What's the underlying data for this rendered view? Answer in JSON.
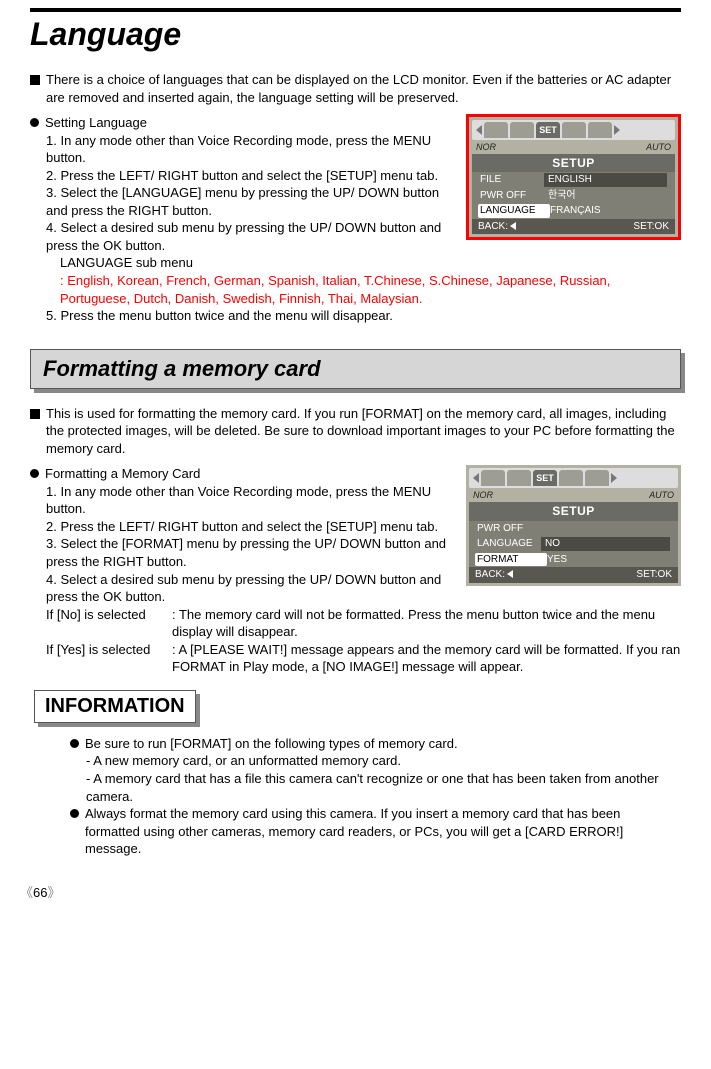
{
  "title_language": "Language",
  "intro_language": "There is a choice of languages that can be displayed on the LCD monitor. Even if the batteries or AC adapter are removed and inserted again, the language setting will be preserved.",
  "setting_language": "Setting Language",
  "steps_lang": {
    "s1": "1. In any mode other than Voice Recording mode, press the MENU button.",
    "s2": "2. Press the LEFT/ RIGHT button and select the [SETUP] menu tab.",
    "s3": "3. Select the [LANGUAGE] menu by pressing the UP/ DOWN button and press the RIGHT button.",
    "s4": "4. Select a desired sub menu by pressing the UP/ DOWN button and press the OK button.",
    "s4b": "LANGUAGE sub menu",
    "s4c": ": English, Korean, French, German, Spanish, Italian, T.Chinese, S.Chinese, Japanese, Russian, Portuguese, Dutch, Danish, Swedish, Finnish, Thai, Malaysian.",
    "s5": "5. Press the menu button twice and the menu will disappear."
  },
  "lcd1": {
    "nor": "NOR",
    "auto": "AUTO",
    "title": "SETUP",
    "tab_set": "SET",
    "r1l": "FILE",
    "r1r": "ENGLISH",
    "r2l": "PWR OFF",
    "r2r": "한국어",
    "r3l": "LANGUAGE",
    "r3r": "FRANÇAIS",
    "back": "BACK:",
    "set": "SET:OK"
  },
  "title_format": "Formatting a memory card",
  "intro_format": "This is used for formatting the memory card. If you run [FORMAT] on the memory card, all images, including the protected images, will be deleted. Be sure to download important images to your PC before formatting the memory card.",
  "formatting_card": "Formatting a Memory Card",
  "steps_fmt": {
    "s1": "1. In any mode other than Voice Recording mode, press the MENU button.",
    "s2": "2. Press the LEFT/ RIGHT button and select the [SETUP] menu tab.",
    "s3": "3. Select the [FORMAT] menu by pressing the UP/ DOWN button and press the RIGHT button.",
    "s4": "4. Select a desired sub menu by pressing the UP/ DOWN button and press the OK button.",
    "no_l": "If [No] is selected",
    "no_r": ": The memory card will not be formatted. Press the menu button twice and the menu display will disappear.",
    "yes_l": "If [Yes] is selected",
    "yes_r": ": A [PLEASE WAIT!] message appears and the memory card will be formatted. If you ran FORMAT in Play mode, a [NO IMAGE!] message will appear."
  },
  "lcd2": {
    "nor": "NOR",
    "auto": "AUTO",
    "title": "SETUP",
    "tab_set": "SET",
    "r1l": "PWR OFF",
    "r1r": "",
    "r2l": "LANGUAGE",
    "r2r": "NO",
    "r3l": "FORMAT",
    "r3r": "YES",
    "back": "BACK:",
    "set": "SET:OK"
  },
  "info_title": "INFORMATION",
  "info": {
    "b1": "Be sure to run [FORMAT] on the following types of memory card.",
    "b1a": "- A new memory card, or an unformatted memory card.",
    "b1b": "- A memory card that has a file this camera can't recognize or one that has been taken from another camera.",
    "b2": "Always format the memory card using this camera. If you insert a memory card that has been formatted using other cameras, memory card readers, or PCs, you will get a [CARD ERROR!] message."
  },
  "page_number": "66"
}
